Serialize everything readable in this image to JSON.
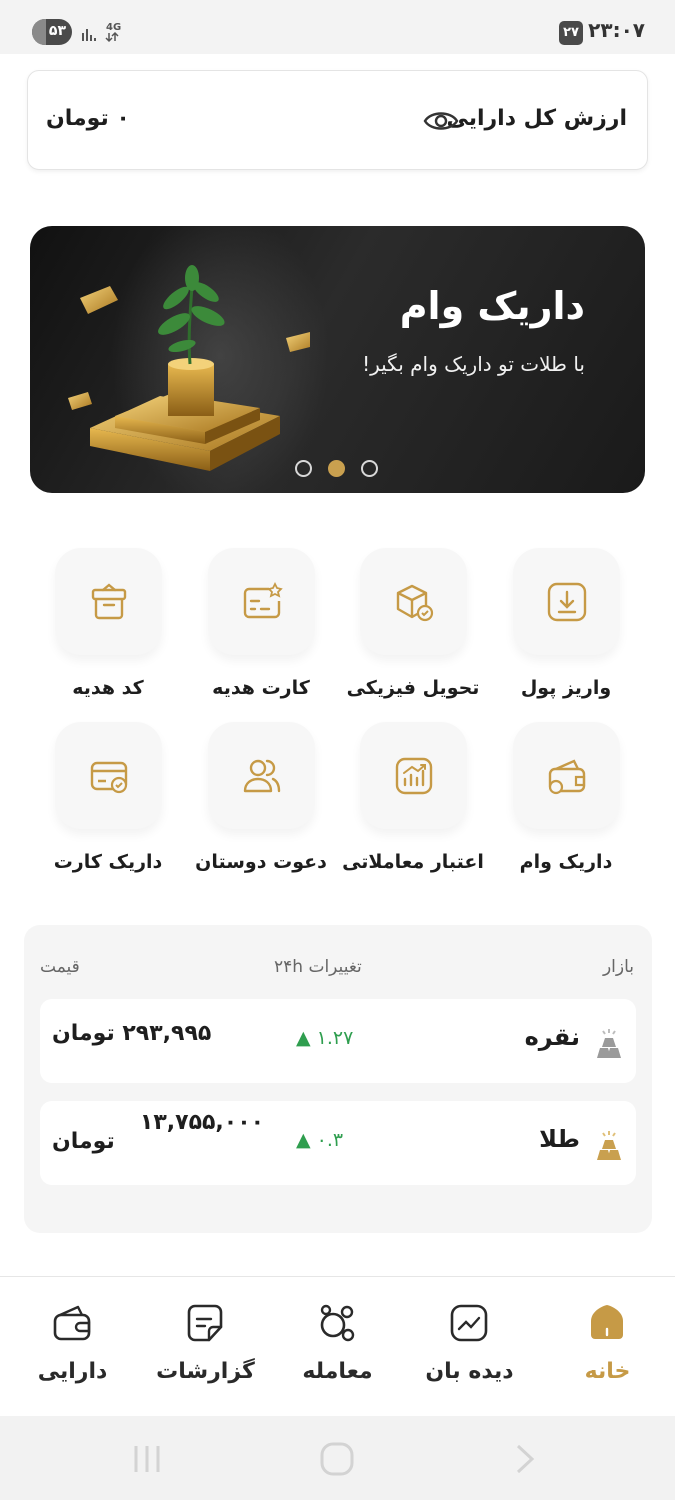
{
  "status_bar": {
    "battery": "۵۳",
    "network": "4G",
    "date": "۲۷",
    "time": "۲۳:۰۷"
  },
  "total": {
    "label": "ارزش کل دارایی",
    "value": "۰ تومان"
  },
  "banner": {
    "title": "داریک وام",
    "subtitle": "با طلات تو داریک وام بگیر!",
    "slide_count": 3,
    "active_slide": 2
  },
  "services": [
    {
      "label": "واریز پول",
      "icon": "deposit-icon"
    },
    {
      "label": "تحویل فیزیکی",
      "icon": "box-delivery-icon"
    },
    {
      "label": "کارت هدیه",
      "icon": "gift-card-icon"
    },
    {
      "label": "کد هدیه",
      "icon": "gift-box-icon"
    },
    {
      "label": "داریک وام",
      "icon": "loan-wallet-icon"
    },
    {
      "label": "اعتبار معاملاتی",
      "icon": "chart-credit-icon"
    },
    {
      "label": "دعوت دوستان",
      "icon": "users-invite-icon"
    },
    {
      "label": "داریک کارت",
      "icon": "card-check-icon"
    }
  ],
  "market": {
    "headers": {
      "market": "بازار",
      "change": "تغییرات ۲۴h",
      "price": "قیمت"
    },
    "rows": [
      {
        "name": "نقره",
        "change": "▲ ۱.۲۷",
        "price": "۲۹۳,۹۹۵ تومان",
        "icon": "silver-bars-icon",
        "color": "#9a9a9a"
      },
      {
        "name": "طلا",
        "change": "▲ ۰.۳",
        "price_number": "۱۳,۷۵۵,۰۰۰",
        "price_unit": "تومان",
        "icon": "gold-bars-icon",
        "color": "#c9a04f"
      }
    ]
  },
  "nav": {
    "items": [
      {
        "label": "خانه",
        "icon": "home-icon",
        "active": true
      },
      {
        "label": "دیده بان",
        "icon": "watchlist-chart-icon",
        "active": false
      },
      {
        "label": "معامله",
        "icon": "trade-circles-icon",
        "active": false
      },
      {
        "label": "گزارشات",
        "icon": "report-doc-icon",
        "active": false
      },
      {
        "label": "دارایی",
        "icon": "wallet-icon",
        "active": false
      }
    ]
  },
  "colors": {
    "accent": "#c69a46",
    "positive": "#2f9e4f",
    "card_bg": "#f7f7f7"
  }
}
